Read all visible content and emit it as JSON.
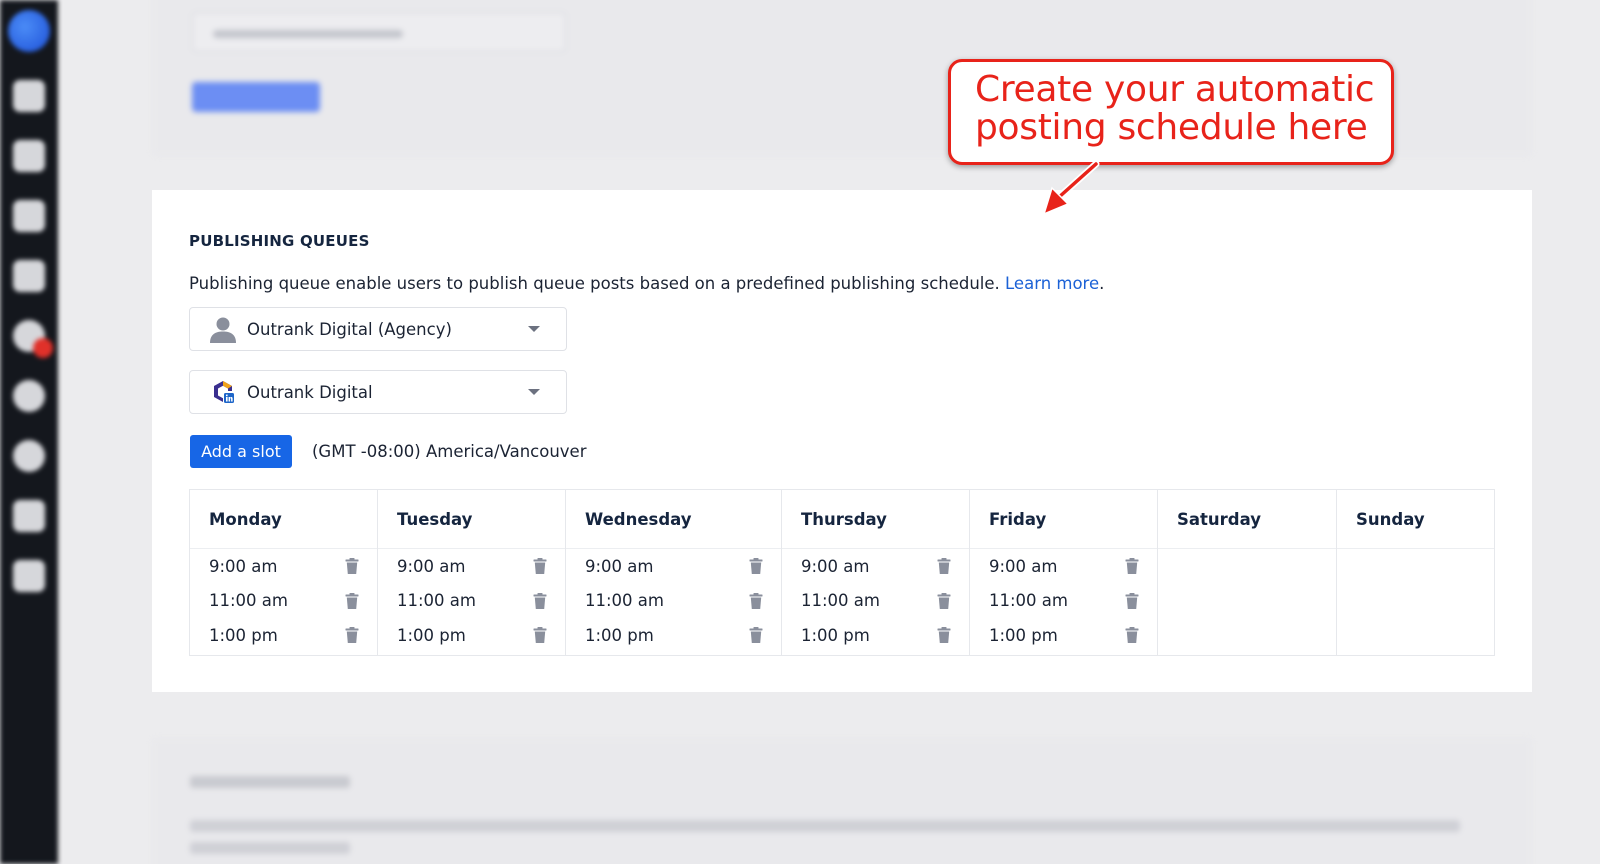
{
  "section": {
    "title": "PUBLISHING QUEUES",
    "description": "Publishing queue enable users to publish queue posts based on a predefined publishing schedule.",
    "learn_more": "Learn more",
    "learn_more_suffix": "."
  },
  "workspace_select": {
    "value": "Outrank Digital (Agency)",
    "icon": "user-avatar-icon"
  },
  "account_select": {
    "value": "Outrank Digital",
    "icon": "linkedin-page-icon"
  },
  "add_slot_label": "Add a slot",
  "timezone": "(GMT -08:00) America/Vancouver",
  "schedule": {
    "days": [
      {
        "name": "Monday",
        "slots": [
          "9:00 am",
          "11:00 am",
          "1:00 pm"
        ]
      },
      {
        "name": "Tuesday",
        "slots": [
          "9:00 am",
          "11:00 am",
          "1:00 pm"
        ]
      },
      {
        "name": "Wednesday",
        "slots": [
          "9:00 am",
          "11:00 am",
          "1:00 pm"
        ]
      },
      {
        "name": "Thursday",
        "slots": [
          "9:00 am",
          "11:00 am",
          "1:00 pm"
        ]
      },
      {
        "name": "Friday",
        "slots": [
          "9:00 am",
          "11:00 am",
          "1:00 pm"
        ]
      },
      {
        "name": "Saturday",
        "slots": []
      },
      {
        "name": "Sunday",
        "slots": []
      }
    ]
  },
  "callout": {
    "line1": "Create your automatic",
    "line2": "posting schedule here"
  },
  "colors": {
    "primary": "#1766e6",
    "link": "#1b61d6",
    "callout_red": "#e8231a",
    "sidebar": "#14171d"
  }
}
